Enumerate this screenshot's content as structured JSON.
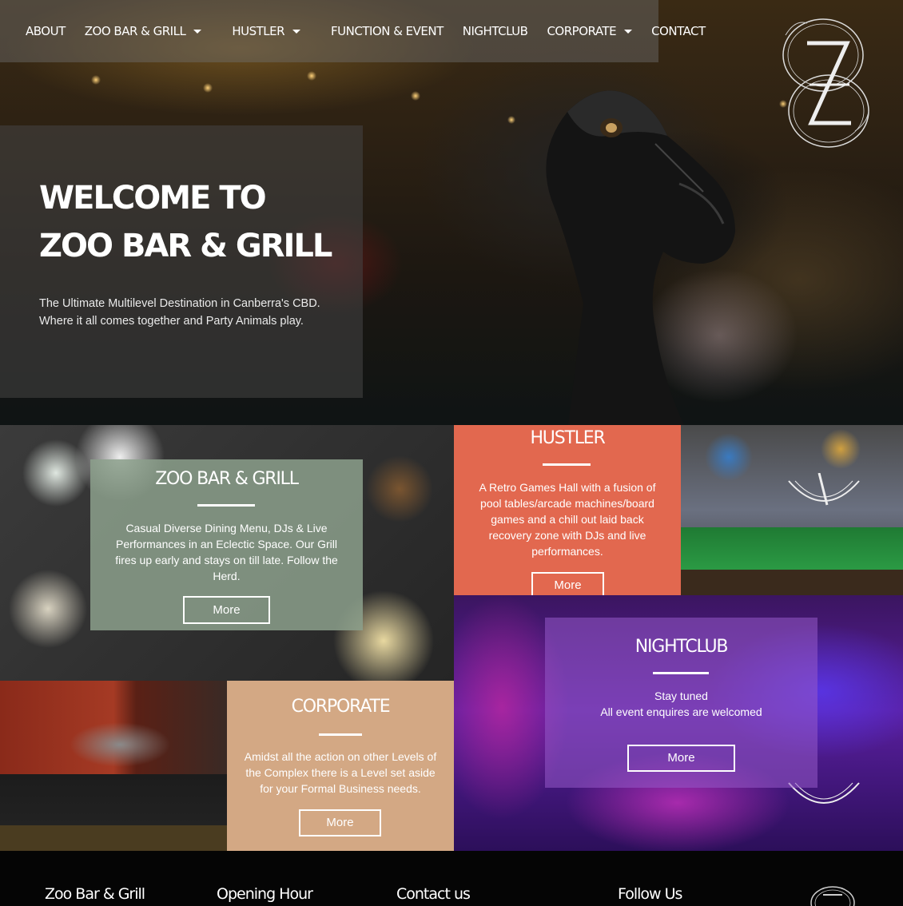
{
  "nav": {
    "items": [
      {
        "label": "ABOUT",
        "dropdown": false
      },
      {
        "label": "ZOO BAR & GRILL",
        "dropdown": true
      },
      {
        "label": "HUSTLER",
        "dropdown": true
      },
      {
        "label": "FUNCTION & EVENT",
        "dropdown": false
      },
      {
        "label": "NIGHTCLUB",
        "dropdown": false
      },
      {
        "label": "CORPORATE",
        "dropdown": true
      },
      {
        "label": "CONTACT",
        "dropdown": false
      }
    ]
  },
  "hero": {
    "title_line1": "WELCOME TO",
    "title_line2": "ZOO BAR & GRILL",
    "subtitle": "The Ultimate Multilevel Destination in Canberra's CBD. Where it all comes together and Party Animals play."
  },
  "sections": {
    "zoo": {
      "title": "ZOO BAR & GRILL",
      "text": "Casual Diverse Dining Menu, DJs & Live Performances in an Eclectic Space. Our Grill fires up early and stays on till late. Follow the Herd.",
      "button": "More"
    },
    "hustler": {
      "title": "HUSTLER",
      "text": "A Retro Games Hall with a fusion of pool tables/arcade machines/board games and a chill out laid back recovery zone with DJs and live performances.",
      "button": "More"
    },
    "nightclub": {
      "title": "NIGHTCLUB",
      "line1": "Stay tuned",
      "line2": "All event enquires are welcomed",
      "button": "More"
    },
    "corporate": {
      "title": "CORPORATE",
      "text": "Amidst all the action on other Levels of the Complex there is a Level set aside for your Formal Business needs.",
      "button": "More"
    }
  },
  "footer": {
    "col1": "Zoo Bar & Grill",
    "col2": "Opening Hour",
    "col3": "Contact us",
    "col4": "Follow Us"
  },
  "colors": {
    "hustler": "#e2684f",
    "corporate": "#d3a884",
    "zoo_box": "#8ca08c",
    "nightclub_box": "#9a5ac8"
  }
}
